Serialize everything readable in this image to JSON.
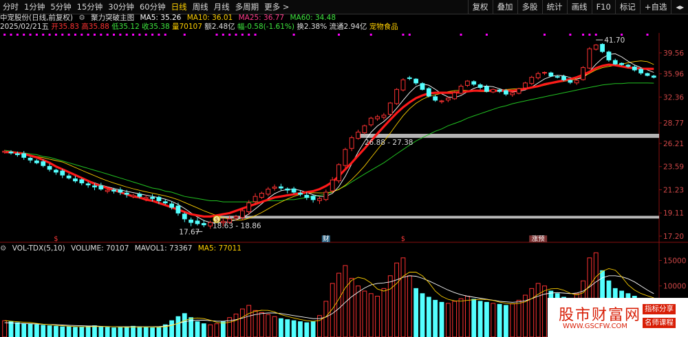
{
  "toolbar": {
    "periods": [
      "分时",
      "1分钟",
      "5分钟",
      "15分钟",
      "30分钟",
      "60分钟",
      "日线",
      "周线",
      "月线",
      "多周期",
      "更多 >"
    ],
    "active_period": "日线",
    "right": [
      "复权",
      "叠加",
      "多股",
      "统计",
      "画线",
      "F10",
      "标记",
      "+自选",
      "◂▸"
    ]
  },
  "legend": {
    "stock": "中宠股份(日线,前复权)",
    "indicator_icon": "gear-icon",
    "indicator": "聚力突破主图",
    "ma5": "MA5: 35.26",
    "ma10": "MA10: 36.01",
    "ma25": "MA25: 36.77",
    "ma60": "MA60: 34.48"
  },
  "quote": {
    "date": "2025/02/21五",
    "open": "开35.83",
    "high": "高35.88",
    "low": "低35.12",
    "close": "收35.38",
    "volume": "量70107",
    "amount": "额2.48亿",
    "change": "幅-0.58(-1.61%)",
    "turnover": "换2.38%",
    "float": "流通2.94亿",
    "sector": "宠物食品"
  },
  "price_axis": [
    "39.56",
    "35.96",
    "32.36",
    "28.77",
    "26.21",
    "23.59",
    "21.23",
    "19.11",
    "17.20"
  ],
  "annotations": {
    "high": "41.70",
    "low": "17.67",
    "zone_upper": "26.88 - 27.38",
    "zone_lower": "18.63 - 18.86"
  },
  "markers": {
    "s1": "$",
    "s2": "财",
    "s3": "$",
    "s4": "涨预",
    "buy": "$"
  },
  "vol_legend": {
    "name": "VOL-TDX(5,10)",
    "volume": "VOLUME: 70107",
    "mavol1": "MAVOL1: 73367",
    "ma5": "MA5: 77011"
  },
  "vol_axis": [
    "15000",
    "10000"
  ],
  "watermark": {
    "main": "股市财富网",
    "url": "WWW.GSCFW.COM",
    "tag1": "指标分享",
    "tag2": "名师课程"
  },
  "colors": {
    "up": "#ff3232",
    "down": "#54ffff",
    "ma_thick": "#ff1a1a",
    "ma60": "#22c422",
    "accent": "#ffd000",
    "magenta": "#ff00ff"
  },
  "chart_data": {
    "type": "candlestick",
    "x_range": [
      "2024-10",
      "2025/02/21"
    ],
    "ylim": [
      17.2,
      41.7
    ],
    "y_ticks": [
      39.56,
      35.96,
      32.36,
      28.77,
      26.21,
      23.59,
      21.23,
      19.11,
      17.2
    ],
    "highest": 41.7,
    "lowest": 17.67,
    "horizontal_zones": [
      [
        26.88,
        27.38
      ],
      [
        18.63,
        18.86
      ]
    ],
    "price_path": [
      25.3,
      25.1,
      24.9,
      24.6,
      24.3,
      24.0,
      23.7,
      23.3,
      23.0,
      22.7,
      22.4,
      22.1,
      21.9,
      21.7,
      21.5,
      21.3,
      21.2,
      21.1,
      21.0,
      20.8,
      20.7,
      20.6,
      20.5,
      20.4,
      20.2,
      20.0,
      19.6,
      19.1,
      18.6,
      18.3,
      18.2,
      18.1,
      18.3,
      18.5,
      18.4,
      18.6,
      18.8,
      19.3,
      20.0,
      20.6,
      20.9,
      21.3,
      21.5,
      21.4,
      21.2,
      21.0,
      20.8,
      20.5,
      20.3,
      20.4,
      21.0,
      22.2,
      23.8,
      25.5,
      26.9,
      27.6,
      28.4,
      29.4,
      29.6,
      29.8,
      31.5,
      33.5,
      35.0,
      35.2,
      34.5,
      33.5,
      32.5,
      31.9,
      31.8,
      32.2,
      33.0,
      34.0,
      34.8,
      34.3,
      33.8,
      33.2,
      33.5,
      33.2,
      32.8,
      33.0,
      33.6,
      34.5,
      35.4,
      36.0,
      36.2,
      35.6,
      35.4,
      35.0,
      34.6,
      34.9,
      37.0,
      40.3,
      41.0,
      39.8,
      38.3,
      37.6,
      37.5,
      37.2,
      36.6,
      36.1,
      35.7,
      35.4
    ],
    "series": [
      {
        "name": "MA25",
        "values": [
          25.2,
          25.2,
          25.1,
          25.0,
          24.8,
          24.6,
          24.3,
          24.0,
          23.6,
          23.3,
          23.0,
          22.7,
          22.4,
          22.1,
          21.8,
          21.6,
          21.4,
          21.2,
          21.0,
          20.8,
          20.6,
          20.5,
          20.3,
          20.2,
          20.0,
          19.8,
          19.6,
          19.4,
          19.2,
          19.0,
          18.9,
          18.8,
          18.8,
          18.9,
          19.0,
          19.1,
          19.3,
          19.5,
          19.7,
          19.9,
          20.1,
          20.3,
          20.5,
          20.6,
          20.7,
          20.8,
          20.9,
          21.0,
          21.1,
          21.3,
          21.6,
          22.0,
          22.6,
          23.3,
          24.0,
          24.8,
          25.6,
          26.5,
          27.4,
          28.3,
          29.2,
          30.1,
          30.9,
          31.6,
          32.2,
          32.6,
          32.9,
          33.0,
          33.0,
          33.0,
          33.0,
          33.1,
          33.2,
          33.3,
          33.3,
          33.3,
          33.3,
          33.3,
          33.3,
          33.3,
          33.4,
          33.6,
          33.8,
          34.0,
          34.3,
          34.5,
          34.7,
          34.9,
          35.1,
          35.4,
          35.8,
          36.3,
          36.9,
          37.3,
          37.5,
          37.4,
          37.2,
          37.0,
          36.9,
          36.8,
          36.8,
          36.77
        ]
      },
      {
        "name": "MA60",
        "values": [
          25.4,
          25.3,
          25.2,
          25.1,
          25.0,
          24.9,
          24.7,
          24.6,
          24.4,
          24.2,
          24.0,
          23.8,
          23.6,
          23.4,
          23.2,
          23.0,
          22.8,
          22.6,
          22.4,
          22.2,
          22.0,
          21.8,
          21.6,
          21.4,
          21.3,
          21.1,
          21.0,
          20.8,
          20.6,
          20.5,
          20.4,
          20.3,
          20.2,
          20.2,
          20.1,
          20.1,
          20.1,
          20.1,
          20.1,
          20.1,
          20.1,
          20.2,
          20.2,
          20.2,
          20.3,
          20.3,
          20.4,
          20.5,
          20.6,
          20.7,
          20.8,
          21.0,
          21.3,
          21.6,
          22.0,
          22.4,
          22.8,
          23.2,
          23.6,
          24.0,
          24.5,
          25.0,
          25.5,
          26.0,
          26.5,
          26.9,
          27.3,
          27.7,
          28.0,
          28.4,
          28.7,
          29.0,
          29.4,
          29.7,
          30.0,
          30.3,
          30.6,
          30.9,
          31.1,
          31.4,
          31.6,
          31.8,
          32.0,
          32.2,
          32.4,
          32.6,
          32.8,
          33.0,
          33.2,
          33.4,
          33.6,
          33.8,
          34.0,
          34.2,
          34.3,
          34.4,
          34.4,
          34.5,
          34.5,
          34.5,
          34.5,
          34.48
        ]
      }
    ],
    "volume_ylim": [
      0,
      16000
    ],
    "volume_ticks": [
      15000,
      10000
    ],
    "volume_last": 70107,
    "volume_values": [
      3200,
      3000,
      2800,
      2600,
      2500,
      2400,
      2300,
      2200,
      2100,
      2000,
      2000,
      1900,
      2000,
      2100,
      2200,
      2000,
      1900,
      1800,
      1900,
      2000,
      2100,
      2000,
      1900,
      1800,
      2000,
      2400,
      3200,
      4000,
      4600,
      3800,
      3000,
      2600,
      2400,
      2600,
      3000,
      3800,
      4500,
      5500,
      6200,
      5200,
      4800,
      4400,
      4000,
      3600,
      3400,
      3200,
      3000,
      2800,
      3000,
      4200,
      7000,
      10500,
      12500,
      14000,
      11500,
      10000,
      9000,
      8500,
      8000,
      9500,
      12000,
      14500,
      15500,
      12000,
      9500,
      8500,
      7800,
      7200,
      6800,
      6600,
      7000,
      7500,
      8000,
      7400,
      7000,
      6800,
      6600,
      6400,
      6200,
      6500,
      7200,
      8200,
      9500,
      10500,
      10000,
      9000,
      8500,
      7800,
      7500,
      8500,
      11000,
      15500,
      16500,
      13000,
      11000,
      9500,
      9000,
      8500,
      8000,
      7600,
      7300,
      7000
    ],
    "volume_ma": [
      2800,
      2750,
      2700,
      2650,
      2600,
      2550,
      2500,
      2450,
      2400,
      2350,
      2300,
      2250,
      2200,
      2150,
      2150,
      2100,
      2050,
      2000,
      2000,
      2000,
      2000,
      2000,
      2000,
      2000,
      2050,
      2150,
      2350,
      2650,
      3000,
      3200,
      3300,
      3300,
      3200,
      3100,
      3100,
      3200,
      3400,
      3700,
      4100,
      4400,
      4600,
      4700,
      4700,
      4600,
      4400,
      4200,
      4000,
      3800,
      3600,
      3600,
      3900,
      4600,
      5600,
      6800,
      7900,
      8800,
      9600,
      10200,
      10500,
      10600,
      10800,
      11200,
      11700,
      12000,
      11900,
      11500,
      11000,
      10400,
      9800,
      9200,
      8700,
      8300,
      8000,
      7800,
      7600,
      7400,
      7200,
      7000,
      6900,
      6800,
      6900,
      7100,
      7500,
      8000,
      8400,
      8600,
      8700,
      8600,
      8500,
      8600,
      9000,
      9800,
      10800,
      11600,
      12000,
      12000,
      11800,
      11400,
      10800,
      10000,
      9200,
      8500
    ]
  }
}
